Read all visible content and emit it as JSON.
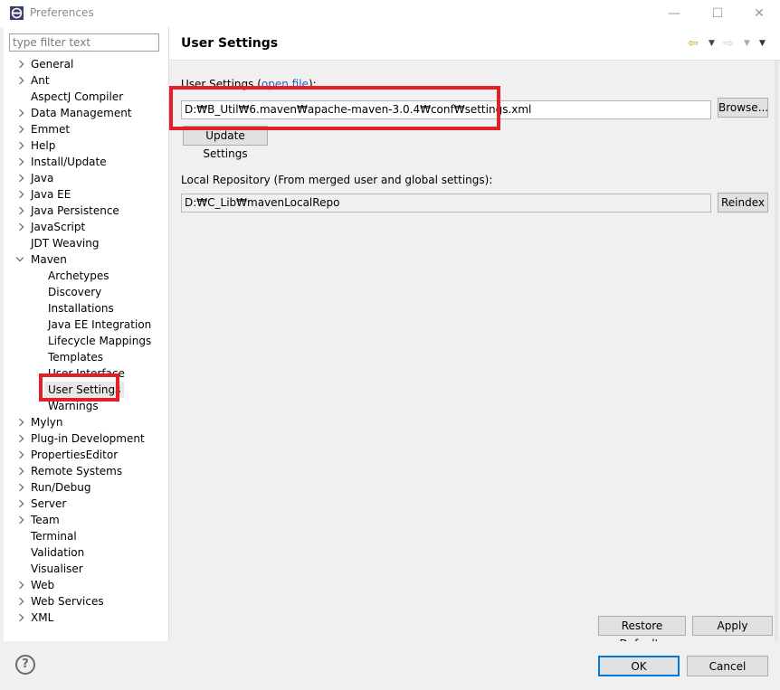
{
  "window": {
    "title": "Preferences",
    "minimize": "—",
    "maximize": "☐",
    "close": "✕"
  },
  "filter": {
    "placeholder": "type filter text"
  },
  "tree": {
    "items": [
      {
        "label": "General",
        "level": 0,
        "expander": "collapsed"
      },
      {
        "label": "Ant",
        "level": 0,
        "expander": "collapsed"
      },
      {
        "label": "AspectJ Compiler",
        "level": 0,
        "expander": "none"
      },
      {
        "label": "Data Management",
        "level": 0,
        "expander": "collapsed"
      },
      {
        "label": "Emmet",
        "level": 0,
        "expander": "collapsed"
      },
      {
        "label": "Help",
        "level": 0,
        "expander": "collapsed"
      },
      {
        "label": "Install/Update",
        "level": 0,
        "expander": "collapsed"
      },
      {
        "label": "Java",
        "level": 0,
        "expander": "collapsed"
      },
      {
        "label": "Java EE",
        "level": 0,
        "expander": "collapsed"
      },
      {
        "label": "Java Persistence",
        "level": 0,
        "expander": "collapsed"
      },
      {
        "label": "JavaScript",
        "level": 0,
        "expander": "collapsed"
      },
      {
        "label": "JDT Weaving",
        "level": 0,
        "expander": "none"
      },
      {
        "label": "Maven",
        "level": 0,
        "expander": "expanded"
      },
      {
        "label": "Archetypes",
        "level": 1,
        "expander": "none"
      },
      {
        "label": "Discovery",
        "level": 1,
        "expander": "none"
      },
      {
        "label": "Installations",
        "level": 1,
        "expander": "none"
      },
      {
        "label": "Java EE Integration",
        "level": 1,
        "expander": "none"
      },
      {
        "label": "Lifecycle Mappings",
        "level": 1,
        "expander": "none"
      },
      {
        "label": "Templates",
        "level": 1,
        "expander": "none"
      },
      {
        "label": "User Interface",
        "level": 1,
        "expander": "none"
      },
      {
        "label": "User Settings",
        "level": 1,
        "expander": "none",
        "selected": true
      },
      {
        "label": "Warnings",
        "level": 1,
        "expander": "none"
      },
      {
        "label": "Mylyn",
        "level": 0,
        "expander": "collapsed"
      },
      {
        "label": "Plug-in Development",
        "level": 0,
        "expander": "collapsed"
      },
      {
        "label": "PropertiesEditor",
        "level": 0,
        "expander": "collapsed"
      },
      {
        "label": "Remote Systems",
        "level": 0,
        "expander": "collapsed"
      },
      {
        "label": "Run/Debug",
        "level": 0,
        "expander": "collapsed"
      },
      {
        "label": "Server",
        "level": 0,
        "expander": "collapsed"
      },
      {
        "label": "Team",
        "level": 0,
        "expander": "collapsed"
      },
      {
        "label": "Terminal",
        "level": 0,
        "expander": "none"
      },
      {
        "label": "Validation",
        "level": 0,
        "expander": "none"
      },
      {
        "label": "Visualiser",
        "level": 0,
        "expander": "none"
      },
      {
        "label": "Web",
        "level": 0,
        "expander": "collapsed"
      },
      {
        "label": "Web Services",
        "level": 0,
        "expander": "collapsed"
      },
      {
        "label": "XML",
        "level": 0,
        "expander": "collapsed"
      }
    ]
  },
  "page": {
    "title": "User Settings",
    "nav": {
      "back": "⇦",
      "forward": "⇨",
      "dropdown": "▼",
      "menu": "▼"
    },
    "user_settings": {
      "label_prefix": "User Settings (",
      "link": "open file",
      "label_suffix": "):",
      "value": "D:₩B_Util₩6.maven₩apache-maven-3.0.4₩conf₩settings.xml",
      "browse": "Browse...",
      "update": "Update Settings"
    },
    "local_repo": {
      "label": "Local Repository (From merged user and global settings):",
      "value": "D:₩C_Lib₩mavenLocalRepo",
      "reindex": "Reindex"
    },
    "restore_defaults": "Restore Defaults",
    "apply": "Apply"
  },
  "footer": {
    "help": "?",
    "ok": "OK",
    "cancel": "Cancel"
  },
  "colors": {
    "highlight": "#e3202a",
    "link": "#1a5fc2",
    "ok_border": "#0078d7"
  }
}
